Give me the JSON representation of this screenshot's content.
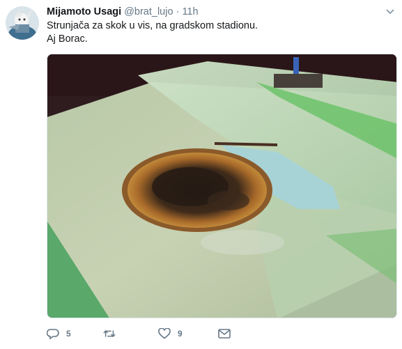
{
  "tweet": {
    "author_name": "Mijamoto Usagi",
    "author_handle": "@brat_lujo",
    "separator": "·",
    "time": "11h",
    "text_lines": [
      "Strunjača za skok u vis, na gradskom stadionu.",
      "Aj Borac."
    ],
    "media_icon": "photo-burned-high-jump-mat",
    "actions": {
      "reply_count": "5",
      "retweet_count": "",
      "like_count": "9"
    }
  },
  "icons": {
    "avatar": "user-avatar",
    "caret": "chevron-down-icon",
    "reply": "reply-icon",
    "retweet": "retweet-icon",
    "like": "heart-icon",
    "dm": "message-icon"
  },
  "colors": {
    "text": "#14171a",
    "muted": "#657786",
    "border": "#e1e8ed"
  }
}
